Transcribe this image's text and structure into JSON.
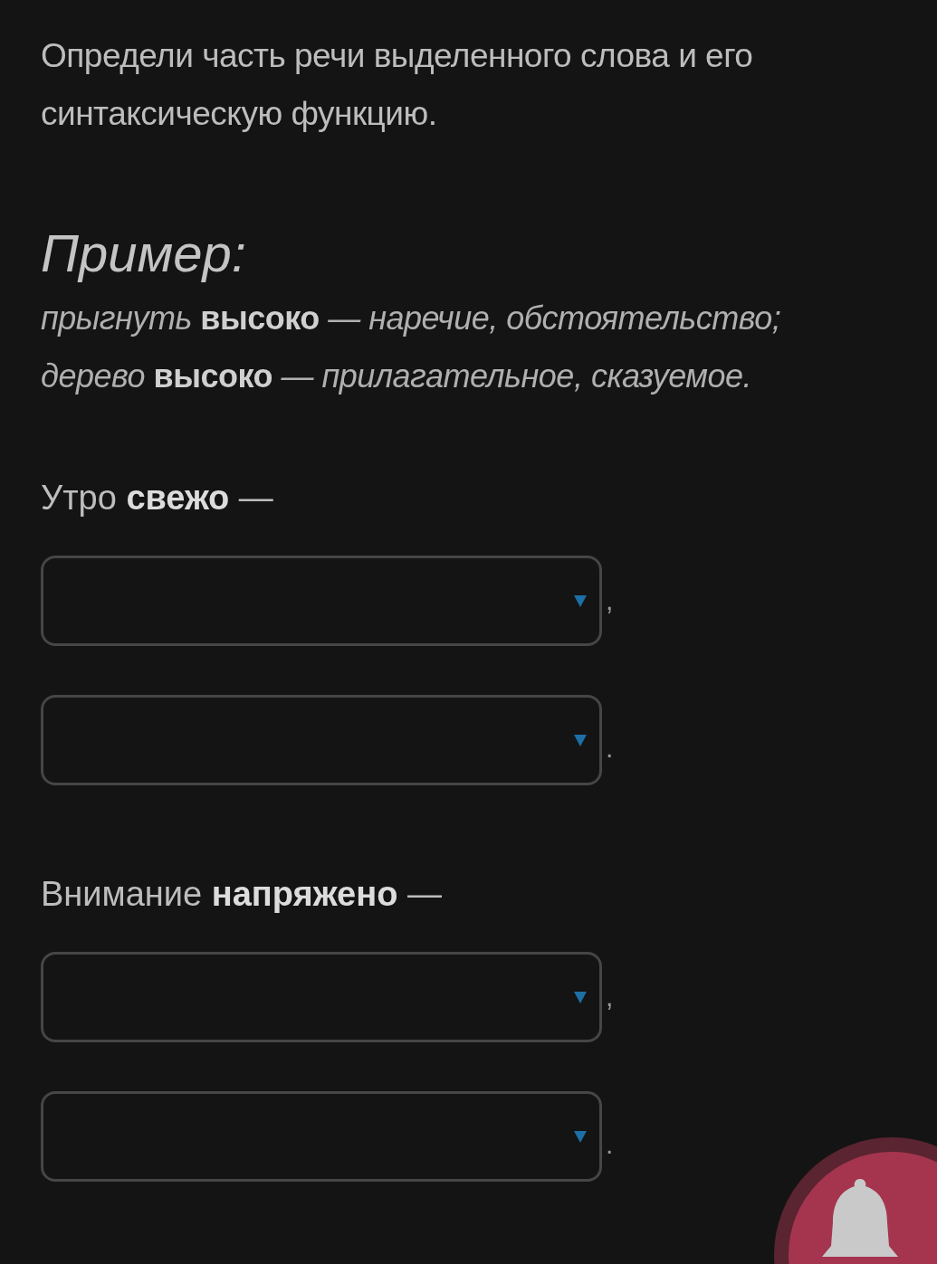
{
  "instruction": "Определи часть речи выделенного слова и его синтаксическую функцию.",
  "example": {
    "heading": "Пример:",
    "lines": [
      "прыгнуть **высоко** — наречие, обстоятельство;",
      "дерево **высоко** — прилагательное, сказуемое."
    ]
  },
  "questions": [
    {
      "sentence": "Утро **свежо** —",
      "answers": [
        {
          "suffix": ","
        },
        {
          "suffix": "."
        }
      ]
    },
    {
      "sentence": "Внимание **напряжено** —",
      "answers": [
        {
          "suffix": ","
        },
        {
          "suffix": "."
        }
      ]
    }
  ],
  "notification_button": {
    "kind": "bell"
  }
}
